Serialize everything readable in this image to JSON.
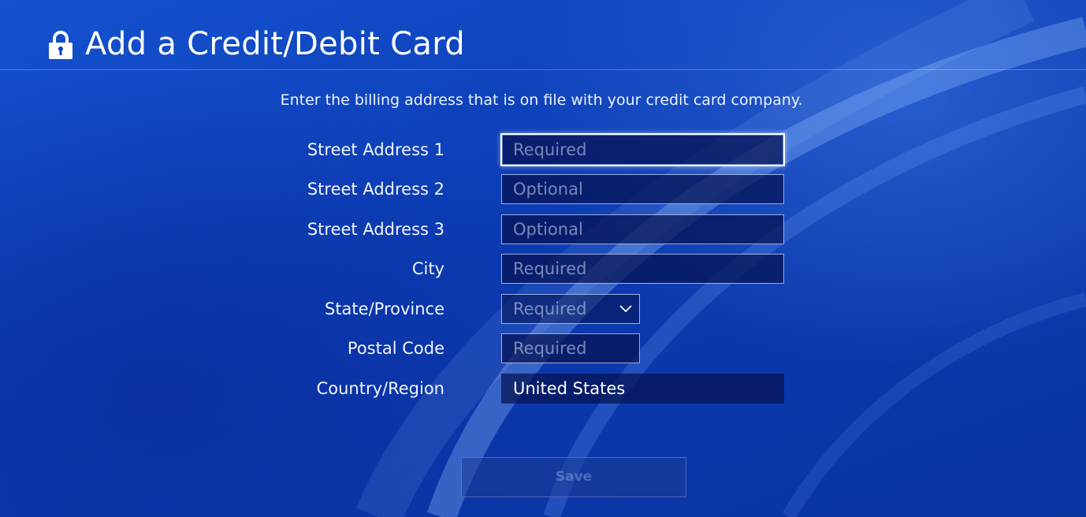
{
  "header": {
    "title": "Add a Credit/Debit Card",
    "icon": "lock-icon"
  },
  "instructions": "Enter the billing address that is on file with your credit card company.",
  "form": {
    "street_address_1": {
      "label": "Street Address 1",
      "placeholder": "Required",
      "value": ""
    },
    "street_address_2": {
      "label": "Street Address 2",
      "placeholder": "Optional",
      "value": ""
    },
    "street_address_3": {
      "label": "Street Address 3",
      "placeholder": "Optional",
      "value": ""
    },
    "city": {
      "label": "City",
      "placeholder": "Required",
      "value": ""
    },
    "state_province": {
      "label": "State/Province",
      "selected": "Required"
    },
    "postal_code": {
      "label": "Postal Code",
      "placeholder": "Required",
      "value": ""
    },
    "country_region": {
      "label": "Country/Region",
      "value": "United States"
    }
  },
  "save_label": "Save",
  "colors": {
    "background": "#0c3fb8",
    "field_bg": "#05124f",
    "text": "#ffffff"
  }
}
